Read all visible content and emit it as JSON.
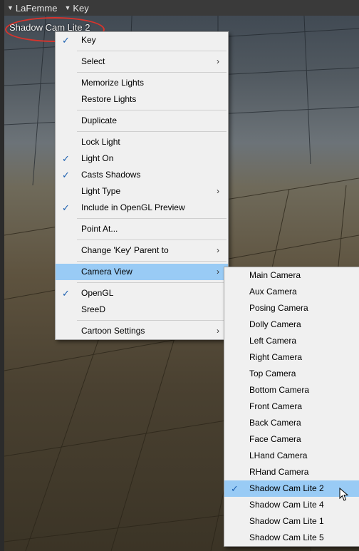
{
  "topbar": {
    "figure_label": "LaFemme",
    "light_label": "Key"
  },
  "camera_label": "Shadow Cam Lite 2",
  "context_menu": {
    "groups": [
      [
        {
          "label": "Key",
          "checked": true,
          "submenu": false
        }
      ],
      [
        {
          "label": "Select",
          "checked": false,
          "submenu": true
        }
      ],
      [
        {
          "label": "Memorize Lights",
          "checked": false,
          "submenu": false
        },
        {
          "label": "Restore Lights",
          "checked": false,
          "submenu": false
        }
      ],
      [
        {
          "label": "Duplicate",
          "checked": false,
          "submenu": false
        }
      ],
      [
        {
          "label": "Lock Light",
          "checked": false,
          "submenu": false
        },
        {
          "label": "Light On",
          "checked": true,
          "submenu": false
        },
        {
          "label": "Casts Shadows",
          "checked": true,
          "submenu": false
        },
        {
          "label": "Light Type",
          "checked": false,
          "submenu": true
        },
        {
          "label": "Include in OpenGL Preview",
          "checked": true,
          "submenu": false
        }
      ],
      [
        {
          "label": "Point At...",
          "checked": false,
          "submenu": false
        }
      ],
      [
        {
          "label": "Change 'Key' Parent to",
          "checked": false,
          "submenu": true
        }
      ],
      [
        {
          "label": "Camera View",
          "checked": false,
          "submenu": true,
          "highlighted": true
        }
      ],
      [
        {
          "label": "OpenGL",
          "checked": true,
          "submenu": false
        },
        {
          "label": "SreeD",
          "checked": false,
          "submenu": false
        }
      ],
      [
        {
          "label": "Cartoon Settings",
          "checked": false,
          "submenu": true
        }
      ]
    ]
  },
  "camera_submenu": {
    "items": [
      {
        "label": "Main Camera",
        "checked": false
      },
      {
        "label": "Aux Camera",
        "checked": false
      },
      {
        "label": "Posing Camera",
        "checked": false
      },
      {
        "label": "Dolly Camera",
        "checked": false
      },
      {
        "label": "Left Camera",
        "checked": false
      },
      {
        "label": "Right Camera",
        "checked": false
      },
      {
        "label": "Top Camera",
        "checked": false
      },
      {
        "label": "Bottom Camera",
        "checked": false
      },
      {
        "label": "Front Camera",
        "checked": false
      },
      {
        "label": "Back Camera",
        "checked": false
      },
      {
        "label": "Face Camera",
        "checked": false
      },
      {
        "label": "LHand Camera",
        "checked": false
      },
      {
        "label": "RHand Camera",
        "checked": false
      },
      {
        "label": "Shadow Cam Lite 2",
        "checked": true,
        "highlighted": true
      },
      {
        "label": "Shadow Cam Lite 4",
        "checked": false
      },
      {
        "label": "Shadow Cam Lite 1",
        "checked": false
      },
      {
        "label": "Shadow Cam Lite 5",
        "checked": false
      }
    ]
  },
  "colors": {
    "highlight": "#99cbf5",
    "check": "#1b5fb0",
    "annotation_ring": "#d9342c",
    "menu_bg": "#f0f0f0"
  }
}
